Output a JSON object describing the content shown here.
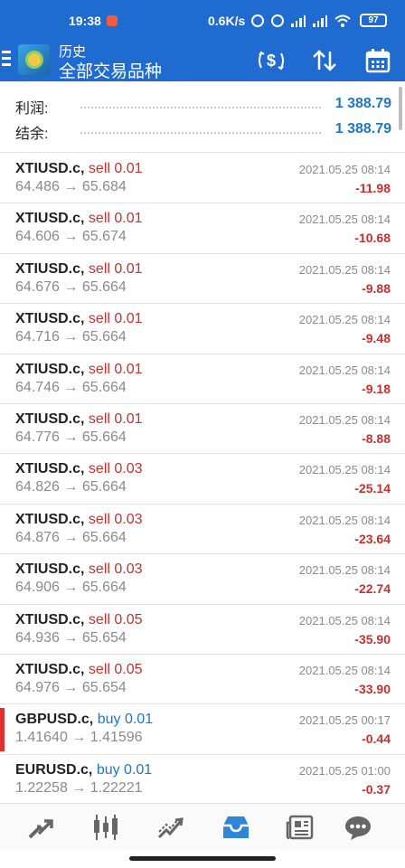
{
  "status_bar": {
    "time": "19:38",
    "speed": "0.6K/s",
    "battery": "97"
  },
  "header": {
    "subtitle": "历史",
    "title": "全部交易品种"
  },
  "summary": {
    "profit_label": "利润:",
    "profit_value": "1 388.79",
    "balance_label": "结余:",
    "balance_value": "1 388.79"
  },
  "trades": [
    {
      "symbol": "XTIUSD.c,",
      "side": "sell 0.01",
      "side_type": "sell",
      "prices": "64.486 → 65.684",
      "datetime": "2021.05.25 08:14",
      "pl": "-11.98"
    },
    {
      "symbol": "XTIUSD.c,",
      "side": "sell 0.01",
      "side_type": "sell",
      "prices": "64.606 → 65.674",
      "datetime": "2021.05.25 08:14",
      "pl": "-10.68"
    },
    {
      "symbol": "XTIUSD.c,",
      "side": "sell 0.01",
      "side_type": "sell",
      "prices": "64.676 → 65.664",
      "datetime": "2021.05.25 08:14",
      "pl": "-9.88"
    },
    {
      "symbol": "XTIUSD.c,",
      "side": "sell 0.01",
      "side_type": "sell",
      "prices": "64.716 → 65.664",
      "datetime": "2021.05.25 08:14",
      "pl": "-9.48"
    },
    {
      "symbol": "XTIUSD.c,",
      "side": "sell 0.01",
      "side_type": "sell",
      "prices": "64.746 → 65.664",
      "datetime": "2021.05.25 08:14",
      "pl": "-9.18"
    },
    {
      "symbol": "XTIUSD.c,",
      "side": "sell 0.01",
      "side_type": "sell",
      "prices": "64.776 → 65.664",
      "datetime": "2021.05.25 08:14",
      "pl": "-8.88"
    },
    {
      "symbol": "XTIUSD.c,",
      "side": "sell 0.03",
      "side_type": "sell",
      "prices": "64.826 → 65.664",
      "datetime": "2021.05.25 08:14",
      "pl": "-25.14"
    },
    {
      "symbol": "XTIUSD.c,",
      "side": "sell 0.03",
      "side_type": "sell",
      "prices": "64.876 → 65.664",
      "datetime": "2021.05.25 08:14",
      "pl": "-23.64"
    },
    {
      "symbol": "XTIUSD.c,",
      "side": "sell 0.03",
      "side_type": "sell",
      "prices": "64.906 → 65.664",
      "datetime": "2021.05.25 08:14",
      "pl": "-22.74"
    },
    {
      "symbol": "XTIUSD.c,",
      "side": "sell 0.05",
      "side_type": "sell",
      "prices": "64.936 → 65.654",
      "datetime": "2021.05.25 08:14",
      "pl": "-35.90"
    },
    {
      "symbol": "XTIUSD.c,",
      "side": "sell 0.05",
      "side_type": "sell",
      "prices": "64.976 → 65.654",
      "datetime": "2021.05.25 08:14",
      "pl": "-33.90"
    },
    {
      "symbol": "GBPUSD.c,",
      "side": "buy 0.01",
      "side_type": "buy",
      "prices": "1.41640 → 1.41596",
      "datetime": "2021.05.25 00:17",
      "pl": "-0.44",
      "highlight": true
    },
    {
      "symbol": "EURUSD.c,",
      "side": "buy 0.01",
      "side_type": "buy",
      "prices": "1.22258 → 1.22221",
      "datetime": "2021.05.25 01:00",
      "pl": "-0.37"
    }
  ],
  "bottom_nav": [
    {
      "name": "nav-quotes",
      "icon": "arrows-diagonal-icon"
    },
    {
      "name": "nav-chart",
      "icon": "candlestick-icon"
    },
    {
      "name": "nav-trade",
      "icon": "trend-line-icon"
    },
    {
      "name": "nav-history",
      "icon": "inbox-icon",
      "active": true
    },
    {
      "name": "nav-news",
      "icon": "newspaper-icon"
    },
    {
      "name": "nav-messages",
      "icon": "chat-bubble-icon"
    }
  ],
  "colors": {
    "primary": "#1f6bd0",
    "sell": "#c9302c",
    "buy": "#1f76c8",
    "muted": "#8a8a8a"
  }
}
